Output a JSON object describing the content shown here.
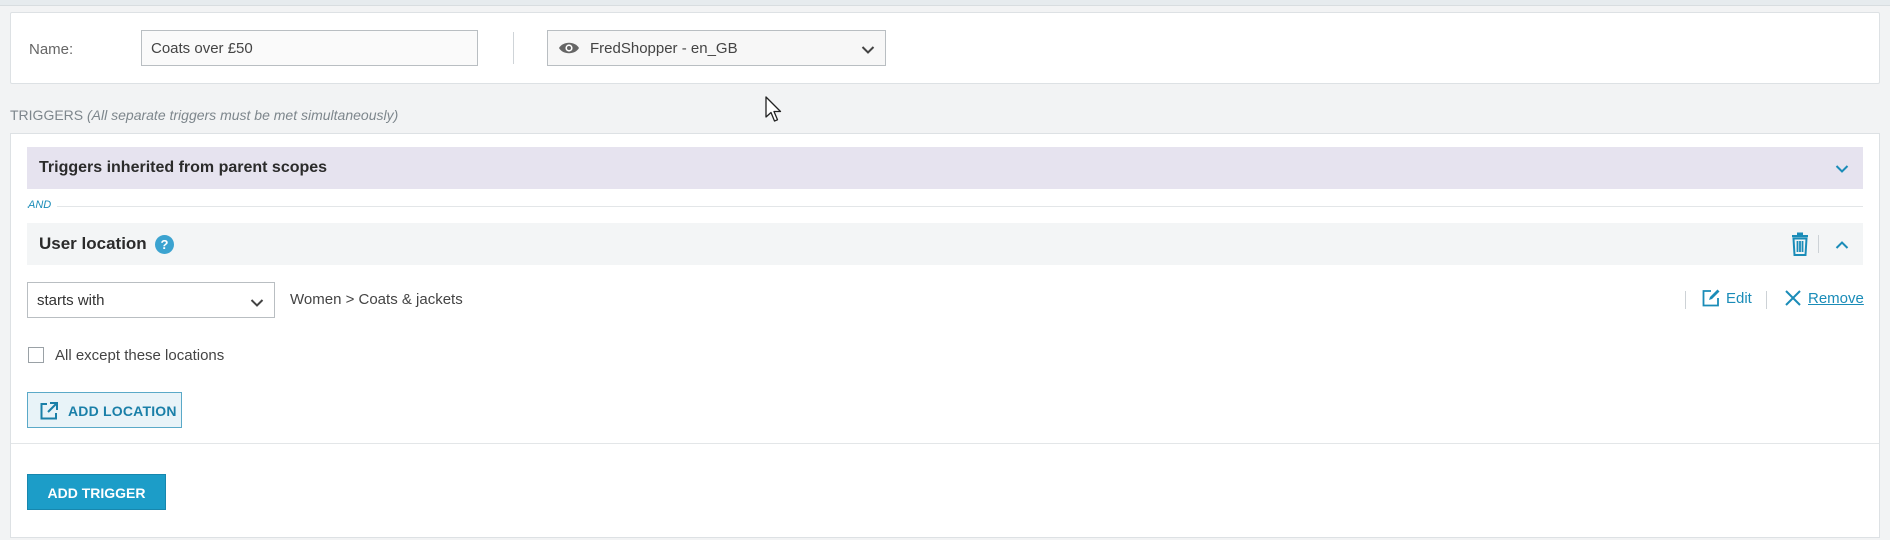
{
  "name_panel": {
    "label": "Name:",
    "value": "Coats over £50",
    "scope": "FredShopper - en_GB"
  },
  "triggers": {
    "heading": "TRIGGERS",
    "note": "(All separate triggers must be met simultaneously)",
    "inherited_title": "Triggers inherited from parent scopes",
    "and_label": "AND",
    "condition": {
      "title": "User location",
      "help": "?",
      "operator": "starts with",
      "location_path": "Women > Coats & jackets",
      "edit_label": "Edit",
      "remove_label": "Remove",
      "except_label": "All except these locations",
      "except_checked": false,
      "add_location_label": "ADD LOCATION"
    },
    "add_trigger_label": "ADD TRIGGER"
  },
  "icons": {
    "scope": "eye-icon",
    "help": "question-icon",
    "delete": "trash-icon",
    "collapse": "chevron-up-icon",
    "expand": "chevron-down-icon",
    "edit": "edit-icon",
    "remove": "close-icon",
    "add_location": "external-link-icon"
  },
  "colors": {
    "accent": "#1c9dc8",
    "link": "#1a8cb8",
    "inherited_bg": "#e6e3ef"
  }
}
